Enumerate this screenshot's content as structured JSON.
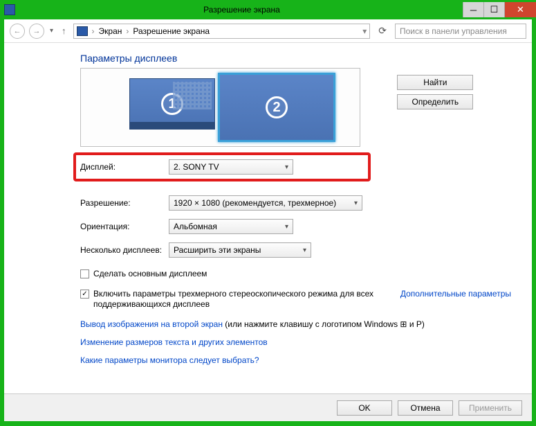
{
  "window": {
    "title": "Разрешение экрана"
  },
  "nav": {
    "crumb1": "Экран",
    "crumb2": "Разрешение экрана",
    "search_placeholder": "Поиск в панели управления"
  },
  "page": {
    "title": "Параметры дисплеев"
  },
  "monitors": {
    "m1": "1",
    "m2": "2"
  },
  "buttons": {
    "find": "Найти",
    "identify": "Определить",
    "ok": "OK",
    "cancel": "Отмена",
    "apply": "Применить"
  },
  "form": {
    "display_label": "Дисплей:",
    "display_value": "2. SONY TV",
    "resolution_label": "Разрешение:",
    "resolution_value": "1920 × 1080 (рекомендуется, трехмерное)",
    "orientation_label": "Ориентация:",
    "orientation_value": "Альбомная",
    "multi_label": "Несколько дисплеев:",
    "multi_value": "Расширить эти экраны"
  },
  "checkboxes": {
    "make_main": "Сделать основным дисплеем",
    "stereo": "Включить параметры трехмерного стереоскопического режима для всех поддерживающихся дисплеев"
  },
  "links": {
    "advanced": "Дополнительные параметры",
    "second_screen_link": "Вывод изображения на второй экран",
    "second_screen_rest": " (или нажмите клавишу с логотипом Windows ⊞ и P)",
    "text_size": "Изменение размеров текста и других элементов",
    "which_settings": "Какие параметры монитора следует выбрать?"
  }
}
